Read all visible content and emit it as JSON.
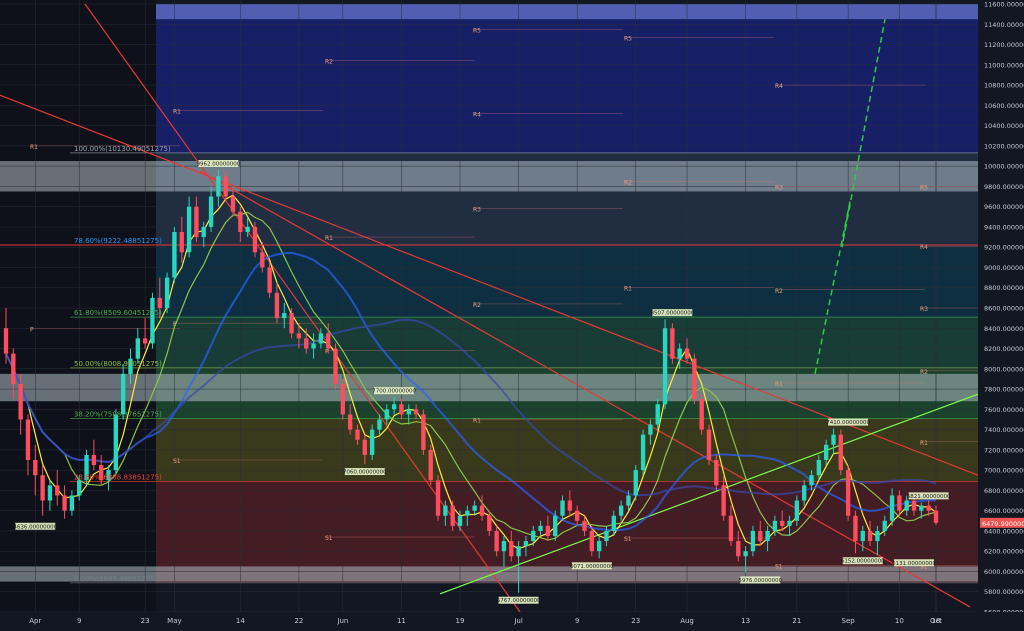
{
  "chart_data": {
    "type": "candlestick",
    "title": "",
    "ylim": [
      5600,
      11600
    ],
    "y_ticks": [
      "11600.00000000",
      "11400.00000000",
      "11200.00000000",
      "11000.00000000",
      "10800.00000000",
      "10600.00000000",
      "10400.00000000",
      "10200.00000000",
      "10000.00000000",
      "9800.00000000",
      "9600.00000000",
      "9400.00000000",
      "9200.00000000",
      "9000.00000000",
      "8800.00000000",
      "8600.00000000",
      "8400.00000000",
      "8200.00000000",
      "8000.00000000",
      "7800.00000000",
      "7600.00000000",
      "7400.00000000",
      "7200.00000000",
      "7000.00000000",
      "6800.00000000",
      "6600.00000000",
      "6400.00000000",
      "6200.00000000",
      "6000.00000000",
      "5800.00000000",
      "5600.00000000"
    ],
    "x_ticks": [
      "Apr",
      "9",
      "23",
      "May",
      "14",
      "22",
      "Jun",
      "11",
      "19",
      "Jul",
      "9",
      "23",
      "Aug",
      "13",
      "21",
      "Sep",
      "10",
      "18",
      "Oct"
    ],
    "current_price": "6479.99000000",
    "fib_levels": [
      {
        "label": "100.00%(10130.49051275)",
        "value": 10130.49,
        "color": "#9aa3b2"
      },
      {
        "label": "78.60%(9222.48851275)",
        "value": 9222.49,
        "color": "#2196f3"
      },
      {
        "label": "61.80%(8509.60451275)",
        "value": 8509.6,
        "color": "#4caf50"
      },
      {
        "label": "50.00%(8008.99051275)",
        "value": 8009.0,
        "color": "#8bc34a"
      },
      {
        "label": "38.20%(7508.37651275)",
        "value": 7508.38,
        "color": "#4caf50"
      },
      {
        "label": "23.60%(6888.83851275)",
        "value": 6888.84,
        "color": "#f44336"
      },
      {
        "label": "0.00%(5887.49051275)",
        "value": 5887.49,
        "color": "#787b86"
      }
    ],
    "peak_labels": [
      {
        "text": "9962.00000000",
        "date": "May 6",
        "value": 9962
      },
      {
        "text": "4636.00000000",
        "date": "Apr 6",
        "value": 6520
      },
      {
        "text": "7700.00000000",
        "date": "Jun 4",
        "value": 7720
      },
      {
        "text": "7060.00000000",
        "date": "May 28",
        "value": 7060
      },
      {
        "text": "5767.00000000",
        "date": "Jun 24",
        "value": 5790
      },
      {
        "text": "6071.00000000",
        "date": "Jul 8",
        "value": 6130
      },
      {
        "text": "8507.00000000",
        "date": "Jul 24",
        "value": 8490
      },
      {
        "text": "5976.00000000",
        "date": "Aug 12",
        "value": 5990
      },
      {
        "text": "7410.00000000",
        "date": "Sep 3",
        "value": 7410
      },
      {
        "text": "6152.00000000",
        "date": "Sep 7",
        "value": 6180
      },
      {
        "text": "6131.00000000",
        "date": "Sep 14",
        "value": 6160
      },
      {
        "text": "6821.00000000",
        "date": "Sep 17",
        "value": 6820
      }
    ],
    "pivot_labels": [
      "R5",
      "R4",
      "R3",
      "R2",
      "R1",
      "P",
      "S1",
      "S2",
      "S3"
    ],
    "ohlc": [
      [
        8400,
        8600,
        8050,
        8150
      ],
      [
        8150,
        8200,
        7700,
        7850
      ],
      [
        7850,
        7950,
        7350,
        7500
      ],
      [
        7500,
        7550,
        6950,
        7100
      ],
      [
        7100,
        7250,
        6750,
        6950
      ],
      [
        6950,
        7050,
        6550,
        6700
      ],
      [
        6700,
        6900,
        6600,
        6850
      ],
      [
        6850,
        7000,
        6650,
        6750
      ],
      [
        6750,
        6850,
        6520,
        6600
      ],
      [
        6600,
        6800,
        6550,
        6750
      ],
      [
        6750,
        6950,
        6700,
        6900
      ],
      [
        6900,
        7200,
        6850,
        7150
      ],
      [
        7150,
        7300,
        7000,
        7050
      ],
      [
        7050,
        7150,
        6850,
        6900
      ],
      [
        6900,
        7050,
        6800,
        7000
      ],
      [
        7000,
        7600,
        6950,
        7550
      ],
      [
        7550,
        8050,
        7500,
        7950
      ],
      [
        7950,
        8200,
        7850,
        8100
      ],
      [
        8100,
        8400,
        8050,
        8300
      ],
      [
        8300,
        8500,
        8200,
        8250
      ],
      [
        8250,
        8750,
        8200,
        8700
      ],
      [
        8700,
        8900,
        8500,
        8600
      ],
      [
        8600,
        8950,
        8550,
        8900
      ],
      [
        8900,
        9400,
        8850,
        9350
      ],
      [
        9350,
        9500,
        9050,
        9150
      ],
      [
        9150,
        9700,
        9100,
        9600
      ],
      [
        9600,
        9700,
        9250,
        9300
      ],
      [
        9300,
        9450,
        9200,
        9400
      ],
      [
        9400,
        9800,
        9350,
        9700
      ],
      [
        9700,
        9962,
        9600,
        9900
      ],
      [
        9900,
        9950,
        9650,
        9700
      ],
      [
        9700,
        9800,
        9500,
        9550
      ],
      [
        9550,
        9600,
        9250,
        9350
      ],
      [
        9350,
        9500,
        9300,
        9400
      ],
      [
        9400,
        9450,
        9100,
        9150
      ],
      [
        9150,
        9250,
        8950,
        9000
      ],
      [
        9000,
        9050,
        8700,
        8750
      ],
      [
        8750,
        8850,
        8450,
        8500
      ],
      [
        8500,
        8650,
        8400,
        8550
      ],
      [
        8550,
        8600,
        8300,
        8350
      ],
      [
        8350,
        8450,
        8200,
        8300
      ],
      [
        8300,
        8400,
        8150,
        8200
      ],
      [
        8200,
        8350,
        8100,
        8250
      ],
      [
        8250,
        8400,
        8200,
        8350
      ],
      [
        8350,
        8450,
        8150,
        8200
      ],
      [
        8200,
        8250,
        7800,
        7850
      ],
      [
        7850,
        7900,
        7500,
        7550
      ],
      [
        7550,
        7650,
        7350,
        7400
      ],
      [
        7400,
        7450,
        7250,
        7300
      ],
      [
        7300,
        7350,
        7060,
        7150
      ],
      [
        7150,
        7450,
        7100,
        7400
      ],
      [
        7400,
        7550,
        7350,
        7500
      ],
      [
        7500,
        7650,
        7450,
        7600
      ],
      [
        7600,
        7720,
        7550,
        7650
      ],
      [
        7650,
        7700,
        7500,
        7550
      ],
      [
        7550,
        7650,
        7450,
        7600
      ],
      [
        7600,
        7650,
        7500,
        7550
      ],
      [
        7550,
        7600,
        7150,
        7200
      ],
      [
        7200,
        7250,
        6850,
        6900
      ],
      [
        6900,
        6950,
        6500,
        6550
      ],
      [
        6550,
        6700,
        6450,
        6650
      ],
      [
        6650,
        6700,
        6400,
        6450
      ],
      [
        6450,
        6600,
        6400,
        6550
      ],
      [
        6550,
        6650,
        6450,
        6600
      ],
      [
        6600,
        6700,
        6550,
        6650
      ],
      [
        6650,
        6750,
        6500,
        6550
      ],
      [
        6550,
        6600,
        6350,
        6400
      ],
      [
        6400,
        6450,
        6150,
        6200
      ],
      [
        6200,
        6350,
        6050,
        6300
      ],
      [
        6300,
        6400,
        6100,
        6150
      ],
      [
        6150,
        6300,
        5790,
        6250
      ],
      [
        6250,
        6350,
        6150,
        6300
      ],
      [
        6300,
        6450,
        6250,
        6400
      ],
      [
        6400,
        6500,
        6350,
        6450
      ],
      [
        6450,
        6550,
        6300,
        6350
      ],
      [
        6350,
        6600,
        6300,
        6550
      ],
      [
        6550,
        6750,
        6500,
        6700
      ],
      [
        6700,
        6800,
        6550,
        6600
      ],
      [
        6600,
        6650,
        6450,
        6500
      ],
      [
        6500,
        6550,
        6350,
        6400
      ],
      [
        6400,
        6450,
        6150,
        6200
      ],
      [
        6200,
        6350,
        6130,
        6300
      ],
      [
        6300,
        6450,
        6250,
        6400
      ],
      [
        6400,
        6600,
        6350,
        6550
      ],
      [
        6550,
        6700,
        6500,
        6650
      ],
      [
        6650,
        6800,
        6600,
        6750
      ],
      [
        6750,
        7050,
        6700,
        7000
      ],
      [
        7000,
        7400,
        6950,
        7350
      ],
      [
        7350,
        7500,
        7250,
        7450
      ],
      [
        7450,
        7700,
        7400,
        7650
      ],
      [
        7650,
        8490,
        7600,
        8400
      ],
      [
        8400,
        8450,
        8050,
        8100
      ],
      [
        8100,
        8250,
        8000,
        8200
      ],
      [
        8200,
        8300,
        8050,
        8100
      ],
      [
        8100,
        8150,
        7650,
        7700
      ],
      [
        7700,
        7750,
        7350,
        7400
      ],
      [
        7400,
        7450,
        7050,
        7100
      ],
      [
        7100,
        7150,
        6800,
        6850
      ],
      [
        6850,
        6950,
        6500,
        6550
      ],
      [
        6550,
        6650,
        6250,
        6300
      ],
      [
        6300,
        6400,
        6100,
        6150
      ],
      [
        6150,
        6250,
        5990,
        6200
      ],
      [
        6200,
        6450,
        6150,
        6400
      ],
      [
        6400,
        6500,
        6250,
        6300
      ],
      [
        6300,
        6450,
        6200,
        6400
      ],
      [
        6400,
        6550,
        6350,
        6500
      ],
      [
        6500,
        6600,
        6400,
        6450
      ],
      [
        6450,
        6550,
        6350,
        6500
      ],
      [
        6500,
        6750,
        6450,
        6700
      ],
      [
        6700,
        6900,
        6650,
        6850
      ],
      [
        6850,
        7000,
        6800,
        6950
      ],
      [
        6950,
        7150,
        6900,
        7100
      ],
      [
        7100,
        7300,
        7050,
        7250
      ],
      [
        7250,
        7410,
        7150,
        7350
      ],
      [
        7350,
        7400,
        6950,
        7000
      ],
      [
        7000,
        7050,
        6500,
        6550
      ],
      [
        6550,
        6600,
        6180,
        6300
      ],
      [
        6300,
        6450,
        6200,
        6400
      ],
      [
        6400,
        6500,
        6250,
        6300
      ],
      [
        6300,
        6450,
        6160,
        6400
      ],
      [
        6400,
        6550,
        6350,
        6500
      ],
      [
        6500,
        6820,
        6450,
        6750
      ],
      [
        6750,
        6800,
        6550,
        6600
      ],
      [
        6600,
        6750,
        6550,
        6700
      ],
      [
        6700,
        6750,
        6550,
        6600
      ],
      [
        6600,
        6680,
        6520,
        6650
      ],
      [
        6650,
        6700,
        6550,
        6600
      ],
      [
        6600,
        6650,
        6460,
        6480
      ]
    ]
  }
}
